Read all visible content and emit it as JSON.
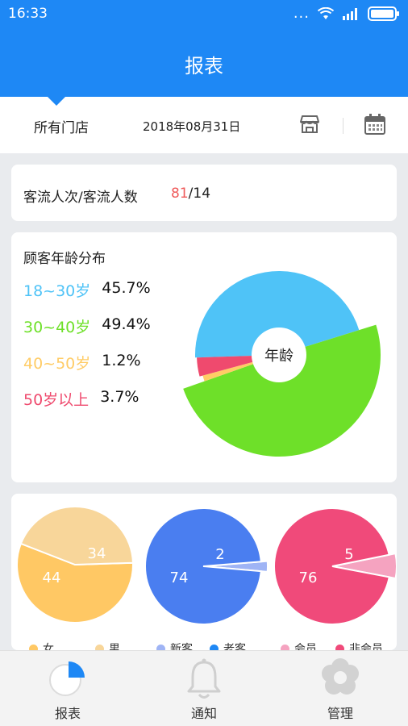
{
  "status": {
    "time": "16:33",
    "dots": "..."
  },
  "header": {
    "title": "报表"
  },
  "filter": {
    "store": "所有门店",
    "date": "2018年08月31日"
  },
  "traffic": {
    "label": "客流人次/客流人数",
    "visits": "81",
    "separator": "/",
    "people": "14"
  },
  "age": {
    "title": "顾客年龄分布",
    "center_label": "年龄",
    "groups": [
      {
        "range": "18~30岁",
        "pct": "45.7%",
        "color": "#4fc3f7"
      },
      {
        "range": "30~40岁",
        "pct": "49.4%",
        "color": "#6ee029"
      },
      {
        "range": "40~50岁",
        "pct": "1.2%",
        "color": "#ffcc66"
      },
      {
        "range": "50岁以上",
        "pct": "3.7%",
        "color": "#ef4a6e"
      }
    ]
  },
  "chart_data": [
    {
      "type": "pie",
      "title": "顾客年龄分布",
      "categories": [
        "18~30岁",
        "30~40岁",
        "40~50岁",
        "50岁以上"
      ],
      "values": [
        45.7,
        49.4,
        1.2,
        3.7
      ],
      "colors": [
        "#4fc3f7",
        "#6ee029",
        "#ffcc66",
        "#ef4a6e"
      ]
    },
    {
      "type": "pie",
      "categories": [
        "女",
        "男"
      ],
      "values": [
        44,
        34
      ],
      "colors": [
        "#ffc864",
        "#f8d69a"
      ]
    },
    {
      "type": "pie",
      "categories": [
        "新客",
        "老客"
      ],
      "values": [
        2,
        74
      ],
      "colors": [
        "#9fb4f5",
        "#4a7ef0"
      ]
    },
    {
      "type": "pie",
      "categories": [
        "会员",
        "非会员"
      ],
      "values": [
        5,
        76
      ],
      "colors": [
        "#f5a3c0",
        "#f04a7a"
      ]
    }
  ],
  "pies": {
    "gender": {
      "female": "44",
      "male": "34"
    },
    "customer": {
      "new": "2",
      "old": "74"
    },
    "member": {
      "member": "5",
      "nonmember": "76"
    }
  },
  "legend": {
    "female": "女",
    "male": "男",
    "new": "新客",
    "old": "老客",
    "member": "会员",
    "nonmember": "非会员"
  },
  "tabs": [
    {
      "label": "报表"
    },
    {
      "label": "通知"
    },
    {
      "label": "管理"
    }
  ]
}
